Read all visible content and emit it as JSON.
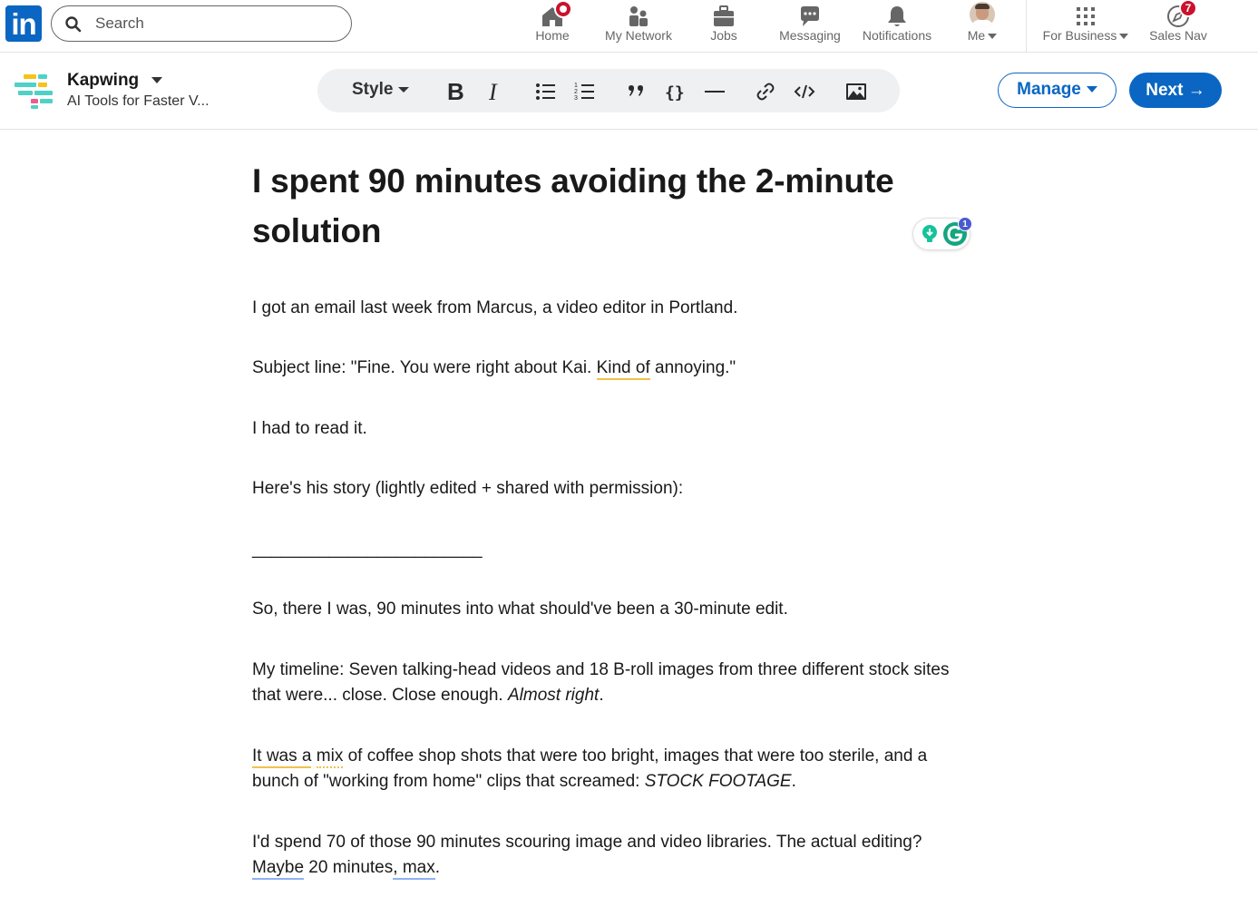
{
  "nav": {
    "logo_text": "in",
    "search_placeholder": "Search",
    "items": [
      {
        "label": "Home",
        "icon": "home-icon"
      },
      {
        "label": "My Network",
        "icon": "people-icon"
      },
      {
        "label": "Jobs",
        "icon": "briefcase-icon"
      },
      {
        "label": "Messaging",
        "icon": "chat-icon"
      },
      {
        "label": "Notifications",
        "icon": "bell-icon"
      },
      {
        "label": "Me",
        "icon": "avatar"
      },
      {
        "label": "For Business",
        "icon": "grid-icon"
      },
      {
        "label": "Sales Nav",
        "icon": "compass-icon"
      }
    ],
    "sales_nav_badge": "7",
    "accent_color": "#0a66c2",
    "badge_color": "#cb112d"
  },
  "editor": {
    "page_name": "Kapwing",
    "page_description": "AI Tools for Faster V...",
    "style_label": "Style",
    "manage_label": "Manage",
    "next_label": "Next →",
    "grammarly_count": "1"
  },
  "article": {
    "title": "I spent 90 minutes avoiding the 2-minute solution",
    "p1": "I got an email last week from Marcus, a video editor in Portland.",
    "p2_a": "Subject line: \"Fine. You were right about Kai. ",
    "p2_b": "Kind of",
    "p2_c": " annoying.\"",
    "p3": "I had to read it.",
    "p4": "Here's his story (lightly edited + shared with permission):",
    "divider": "________________________",
    "p5": "So, there I was, 90 minutes into what should've been a 30-minute edit.",
    "p6_a": "My timeline: Seven talking-head videos and 18 B-roll images from three different stock sites that were... close. Close enough. ",
    "p6_b": "Almost right",
    "p6_c": ".",
    "p7_a": "It was a",
    "p7_b": " ",
    "p7_c": "mix",
    "p7_d": " of coffee shop shots that were too bright, images that were too sterile, and a bunch of \"working from home\" clips that screamed: ",
    "p7_e": "STOCK FOOTAGE",
    "p7_f": ".",
    "p8_a": "I'd spend 70 of those 90 minutes scouring image and video libraries. The actual editing? ",
    "p8_b": "Maybe",
    "p8_c": " 20 minutes",
    "p8_d": ", max",
    "p8_e": "."
  }
}
